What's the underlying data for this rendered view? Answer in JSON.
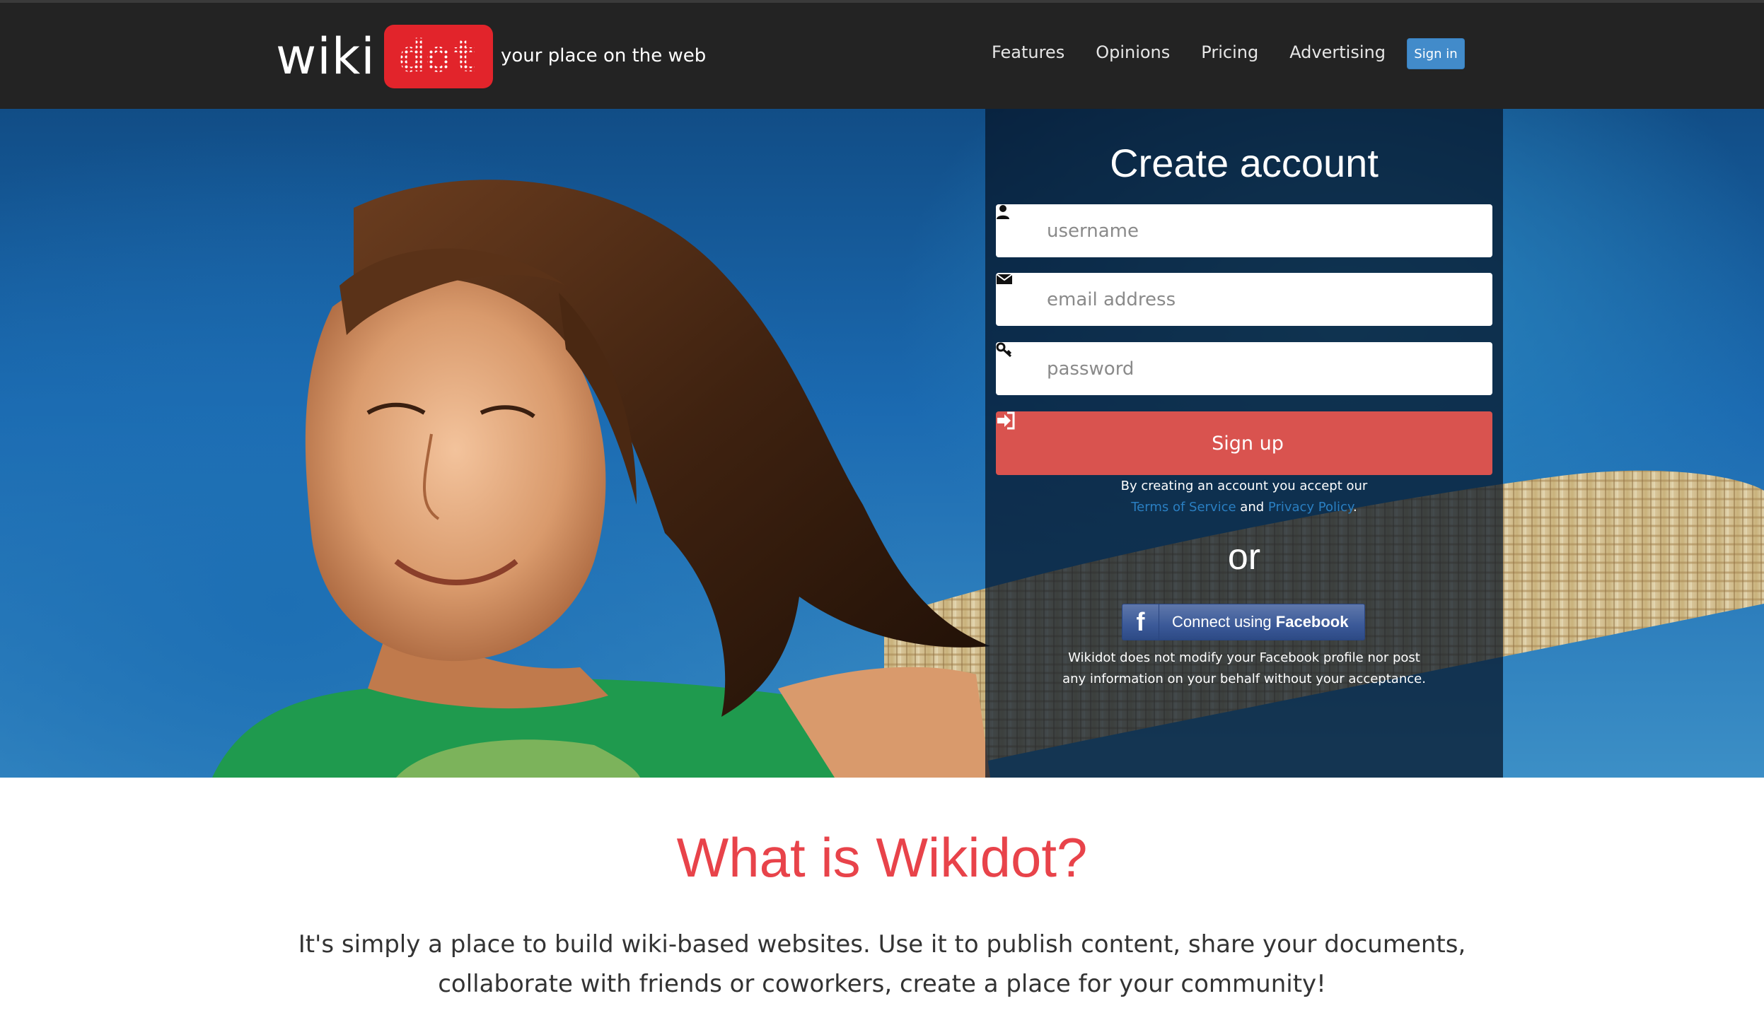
{
  "header": {
    "brand_wiki": "wiki",
    "brand_dot": "dot",
    "tagline": "your place on the web",
    "nav": [
      "Features",
      "Opinions",
      "Pricing",
      "Advertising"
    ],
    "signin_label": "Sign in"
  },
  "signup": {
    "title": "Create account",
    "username_placeholder": "username",
    "email_placeholder": "email address",
    "password_placeholder": "password",
    "button_label": "Sign up",
    "terms_prefix": "By creating an account you accept our",
    "terms_link": "Terms of Service",
    "terms_and": "and",
    "privacy_link": "Privacy Policy",
    "terms_suffix": ".",
    "or": "or",
    "facebook_prefix": "Connect using",
    "facebook_brand": "Facebook",
    "facebook_icon": "f",
    "facebook_note": "Wikidot does not modify your Facebook profile nor post any information on your behalf without your acceptance."
  },
  "about": {
    "title": "What is Wikidot?",
    "description": "It's simply a place to build wiki-based websites. Use it to publish content, share your documents, collaborate with friends or coworkers, create a place for your community!"
  },
  "icons": {
    "username": "user-icon",
    "email": "envelope-icon",
    "password": "key-icon",
    "signup": "sign-in-icon",
    "facebook": "facebook-icon"
  },
  "colors": {
    "navbar": "#232323",
    "brand_red": "#e2242b",
    "signin_blue": "#428bca",
    "signup_red": "#d9534f",
    "facebook_blue": "#3b5998",
    "heading_red": "#e8434a",
    "link_blue": "#2a7fc2"
  }
}
